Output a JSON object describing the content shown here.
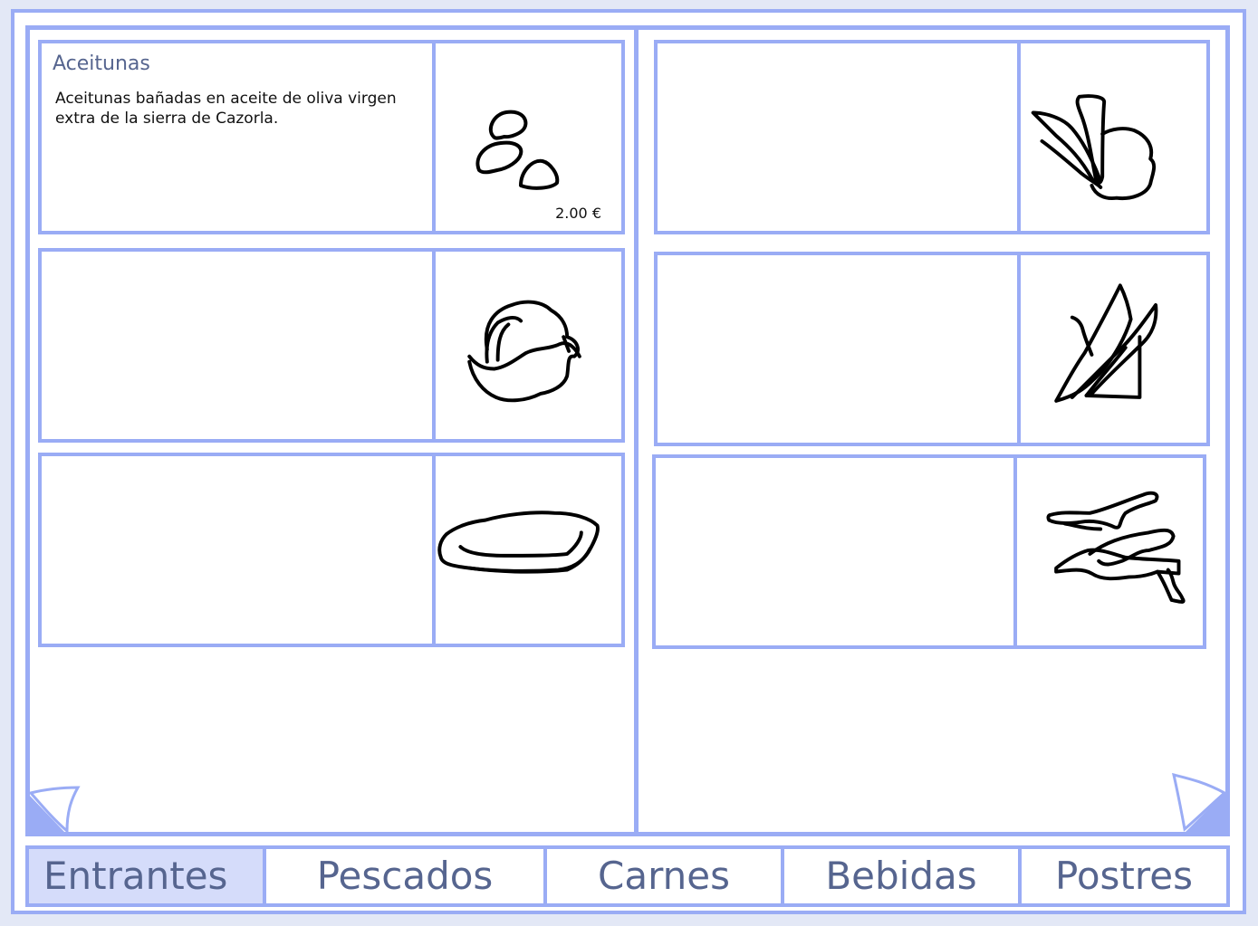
{
  "menu": {
    "left_page": {
      "items": [
        {
          "title": "Aceitunas",
          "description": "Aceitunas bañadas en aceite de oliva virgen extra de la sierra de Cazorla.",
          "price": "2.00 €",
          "icon": "olives-drawing"
        },
        {
          "title": "",
          "description": "",
          "price": "",
          "icon": "cheese-ball-drawing"
        },
        {
          "title": "",
          "description": "",
          "price": "",
          "icon": "flatbread-drawing"
        }
      ]
    },
    "right_page": {
      "items": [
        {
          "title": "",
          "description": "",
          "price": "",
          "icon": "asparagus-drawing"
        },
        {
          "title": "",
          "description": "",
          "price": "",
          "icon": "cheese-wedge-drawing"
        },
        {
          "title": "",
          "description": "",
          "price": "",
          "icon": "peppers-drawing"
        }
      ]
    }
  },
  "tabs": [
    {
      "label": "Entrantes",
      "active": true
    },
    {
      "label": "Pescados",
      "active": false
    },
    {
      "label": "Carnes",
      "active": false
    },
    {
      "label": "Bebidas",
      "active": false
    },
    {
      "label": "Postres",
      "active": false
    }
  ],
  "colors": {
    "accent": "#9aacf5",
    "active_tab": "#d5dcfa",
    "text": "#56658f"
  }
}
